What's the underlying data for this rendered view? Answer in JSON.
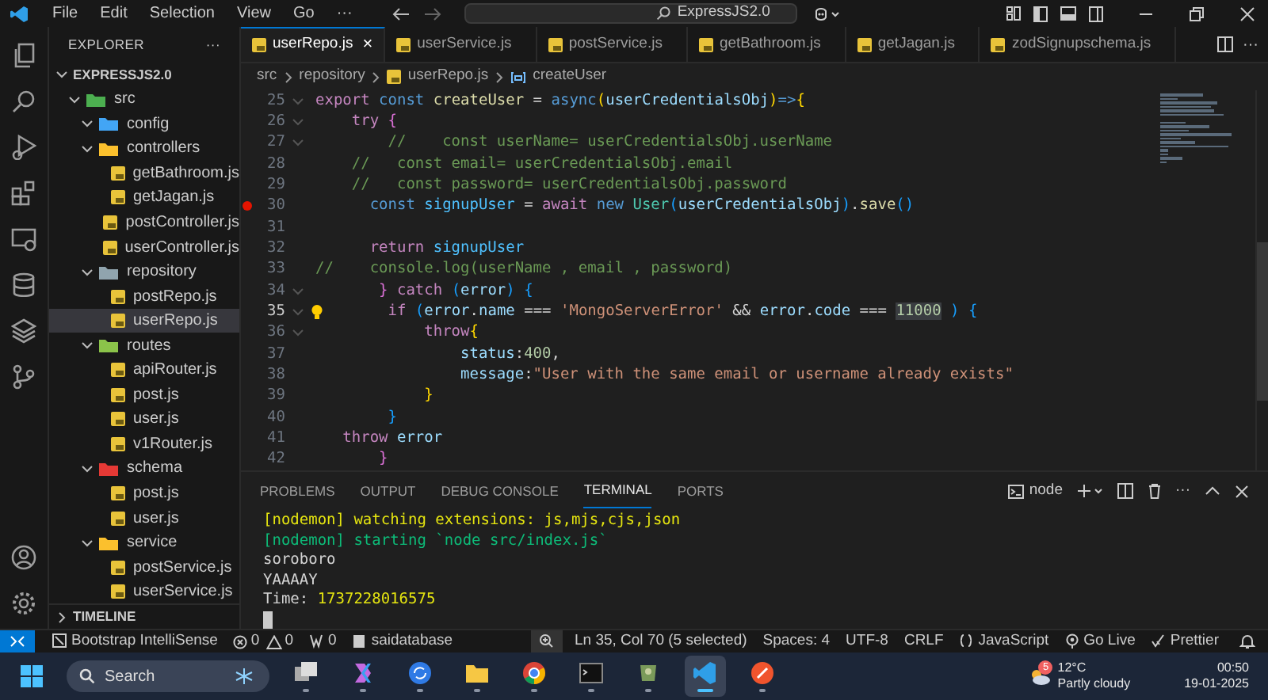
{
  "menu": [
    "File",
    "Edit",
    "Selection",
    "View",
    "Go",
    "···"
  ],
  "command_center": {
    "text": "ExpressJS2.0"
  },
  "explorer": {
    "title": "EXPLORER",
    "more": "···",
    "root": "EXPRESSJS2.0",
    "tree": [
      {
        "label": "src",
        "kind": "folder",
        "color": "#4caf50",
        "expanded": true,
        "selected": false,
        "children": [
          {
            "label": "config",
            "kind": "folder",
            "color": "#42a5f5",
            "expanded": true,
            "selected": false
          },
          {
            "label": "controllers",
            "kind": "folder",
            "color": "#fbc02d",
            "expanded": true,
            "selected": false,
            "children": [
              {
                "label": "getBathroom.js",
                "kind": "file",
                "selected": false
              },
              {
                "label": "getJagan.js",
                "kind": "file",
                "selected": false
              },
              {
                "label": "postController.js",
                "kind": "file",
                "selected": false
              },
              {
                "label": "userController.js",
                "kind": "file",
                "selected": false
              }
            ]
          },
          {
            "label": "repository",
            "kind": "folder",
            "color": "#90a4ae",
            "expanded": true,
            "selected": false,
            "children": [
              {
                "label": "postRepo.js",
                "kind": "file",
                "selected": false
              },
              {
                "label": "userRepo.js",
                "kind": "file",
                "selected": true
              }
            ]
          },
          {
            "label": "routes",
            "kind": "folder",
            "color": "#8bc34a",
            "expanded": true,
            "selected": false,
            "children": [
              {
                "label": "apiRouter.js",
                "kind": "file",
                "selected": false
              },
              {
                "label": "post.js",
                "kind": "file",
                "selected": false
              },
              {
                "label": "user.js",
                "kind": "file",
                "selected": false
              },
              {
                "label": "v1Router.js",
                "kind": "file",
                "selected": false
              }
            ]
          },
          {
            "label": "schema",
            "kind": "folder",
            "color": "#e53935",
            "expanded": true,
            "selected": false,
            "children": [
              {
                "label": "post.js",
                "kind": "file",
                "selected": false
              },
              {
                "label": "user.js",
                "kind": "file",
                "selected": false
              }
            ]
          },
          {
            "label": "service",
            "kind": "folder",
            "color": "#fbc02d",
            "expanded": true,
            "selected": false,
            "children": [
              {
                "label": "postService.js",
                "kind": "file",
                "selected": false
              },
              {
                "label": "userService.js",
                "kind": "file",
                "selected": false
              }
            ]
          }
        ]
      }
    ],
    "timeline": "TIMELINE"
  },
  "tabs": [
    {
      "label": "userRepo.js",
      "selected": true,
      "close": "×"
    },
    {
      "label": "userService.js",
      "selected": false
    },
    {
      "label": "postService.js",
      "selected": false
    },
    {
      "label": "getBathroom.js",
      "selected": false
    },
    {
      "label": "getJagan.js",
      "selected": false
    },
    {
      "label": "zodSignupschema.js",
      "selected": false
    }
  ],
  "tabs_more": "···",
  "breadcrumbs": [
    "src",
    "repository",
    "userRepo.js",
    "createUser"
  ],
  "code": [
    {
      "number": "25",
      "fold": true,
      "tokens": [
        {
          "kind": "ctrl",
          "text": "export "
        },
        {
          "kind": "kw",
          "text": "const "
        },
        {
          "kind": "fn",
          "text": "createUser "
        },
        {
          "kind": "plain",
          "text": "= "
        },
        {
          "kind": "kw",
          "text": "async"
        },
        {
          "kind": "brace",
          "text": "("
        },
        {
          "kind": "var",
          "text": "userCredentialsObj"
        },
        {
          "kind": "brace",
          "text": ")"
        },
        {
          "kind": "kw",
          "text": "=>"
        },
        {
          "kind": "brace",
          "text": "{"
        }
      ]
    },
    {
      "number": "26",
      "fold": true,
      "tokens": [
        {
          "kind": "ctrl",
          "text": "    try "
        },
        {
          "kind": "brace2",
          "text": "{"
        }
      ]
    },
    {
      "number": "27",
      "fold": true,
      "tokens": [
        {
          "kind": "cmt",
          "text": "        //    const userName= userCredentialsObj.userName"
        }
      ]
    },
    {
      "number": "28",
      "tokens": [
        {
          "kind": "cmt",
          "text": "    //   const email= userCredentialsObj.email"
        }
      ]
    },
    {
      "number": "29",
      "tokens": [
        {
          "kind": "cmt",
          "text": "    //   const password= userCredentialsObj.password"
        }
      ]
    },
    {
      "number": "30",
      "breakpoint": true,
      "tokens": [
        {
          "kind": "kw",
          "text": "      const "
        },
        {
          "kind": "cvar",
          "text": "signupUser "
        },
        {
          "kind": "plain",
          "text": "= "
        },
        {
          "kind": "ctrl",
          "text": "await "
        },
        {
          "kind": "kw",
          "text": "new "
        },
        {
          "kind": "type",
          "text": "User"
        },
        {
          "kind": "brace3",
          "text": "("
        },
        {
          "kind": "var",
          "text": "userCredentialsObj"
        },
        {
          "kind": "brace3",
          "text": ")"
        },
        {
          "kind": "plain",
          "text": "."
        },
        {
          "kind": "fn",
          "text": "save"
        },
        {
          "kind": "brace3",
          "text": "()"
        }
      ]
    },
    {
      "number": "31"
    },
    {
      "number": "32",
      "tokens": [
        {
          "kind": "ctrl",
          "text": "      return "
        },
        {
          "kind": "cvar",
          "text": "signupUser"
        }
      ]
    },
    {
      "number": "33",
      "tokens": [
        {
          "kind": "cmt",
          "text": "//    console.log(userName , email , password)"
        }
      ]
    },
    {
      "number": "34",
      "fold": true,
      "tokens": [
        {
          "kind": "brace2",
          "text": "       } "
        },
        {
          "kind": "ctrl",
          "text": "catch "
        },
        {
          "kind": "brace3",
          "text": "("
        },
        {
          "kind": "var",
          "text": "error"
        },
        {
          "kind": "brace3",
          "text": ") "
        },
        {
          "kind": "brace3",
          "text": "{"
        }
      ]
    },
    {
      "number": "35",
      "fold": true,
      "current": true,
      "lightbulb": true,
      "tokens": [
        {
          "kind": "ctrl",
          "text": "        if "
        },
        {
          "kind": "brace3",
          "text": "("
        },
        {
          "kind": "var",
          "text": "error"
        },
        {
          "kind": "plain",
          "text": "."
        },
        {
          "kind": "var",
          "text": "name"
        },
        {
          "kind": "plain",
          "text": " === "
        },
        {
          "kind": "str",
          "text": "'MongoServerError'"
        },
        {
          "kind": "plain",
          "text": " && "
        },
        {
          "kind": "var",
          "text": "error"
        },
        {
          "kind": "plain",
          "text": "."
        },
        {
          "kind": "var",
          "text": "code"
        },
        {
          "kind": "plain",
          "text": " === "
        },
        {
          "kind": "selnum",
          "text": "11000"
        },
        {
          "kind": "brace3",
          "text": " ) {"
        }
      ]
    },
    {
      "number": "36",
      "fold": true,
      "tokens": [
        {
          "kind": "ctrl",
          "text": "            throw"
        },
        {
          "kind": "brace",
          "text": "{"
        }
      ]
    },
    {
      "number": "37",
      "tokens": [
        {
          "kind": "var",
          "text": "                status"
        },
        {
          "kind": "plain",
          "text": ":"
        },
        {
          "kind": "num",
          "text": "400"
        },
        {
          "kind": "plain",
          "text": ","
        }
      ]
    },
    {
      "number": "38",
      "tokens": [
        {
          "kind": "var",
          "text": "                message"
        },
        {
          "kind": "plain",
          "text": ":"
        },
        {
          "kind": "str",
          "text": "\"User with the same email or username already exists\""
        }
      ]
    },
    {
      "number": "39",
      "tokens": [
        {
          "kind": "brace",
          "text": "            }"
        }
      ]
    },
    {
      "number": "40",
      "tokens": [
        {
          "kind": "brace3",
          "text": "        }"
        }
      ]
    },
    {
      "number": "41",
      "tokens": [
        {
          "kind": "ctrl",
          "text": "   throw "
        },
        {
          "kind": "var",
          "text": "error"
        }
      ]
    },
    {
      "number": "42",
      "tokens": [
        {
          "kind": "brace2",
          "text": "       }"
        }
      ]
    }
  ],
  "panel": {
    "tabs": [
      {
        "label": "PROBLEMS",
        "selected": false
      },
      {
        "label": "OUTPUT",
        "selected": false
      },
      {
        "label": "DEBUG CONSOLE",
        "selected": false
      },
      {
        "label": "TERMINAL",
        "selected": true
      },
      {
        "label": "PORTS",
        "selected": false
      }
    ],
    "terminal_name": "node",
    "more": "···",
    "lines": [
      [
        {
          "kind": "yellow",
          "text": "[nodemon] watching extensions: js,mjs,cjs,json"
        }
      ],
      [
        {
          "kind": "green",
          "text": "[nodemon] starting `node src/index.js`"
        }
      ],
      [
        {
          "kind": "plain",
          "text": "soroboro"
        }
      ],
      [
        {
          "kind": "plain",
          "text": "YAAAAY"
        }
      ],
      [
        {
          "kind": "plain",
          "text": "Time: "
        },
        {
          "kind": "yellow",
          "text": "1737228016575"
        }
      ]
    ]
  },
  "status_bar": {
    "left": [
      {
        "kind": "ext",
        "text": "Bootstrap IntelliSense"
      },
      {
        "kind": "problems",
        "errors": "0",
        "warnings": "0"
      },
      {
        "kind": "ports",
        "text": "0"
      },
      {
        "kind": "db",
        "text": "saidatabase"
      }
    ],
    "right": [
      {
        "kind": "plain",
        "text": "Ln 35, Col 70 (5 selected)"
      },
      {
        "kind": "plain",
        "text": "Spaces: 4"
      },
      {
        "kind": "plain",
        "text": "UTF-8"
      },
      {
        "kind": "plain",
        "text": "CRLF"
      },
      {
        "kind": "lang",
        "text": "JavaScript"
      },
      {
        "kind": "live",
        "text": "Go Live"
      },
      {
        "kind": "prettier",
        "text": "Prettier"
      }
    ]
  },
  "taskbar": {
    "search_placeholder": "Search",
    "weather": {
      "badge": "5",
      "temp": "12°C",
      "condition": "Partly cloudy"
    },
    "time": "00:50",
    "date": "19-01-2025",
    "apps": [
      {
        "kind": "taskview",
        "active": false
      },
      {
        "kind": "copilot",
        "active": false
      },
      {
        "kind": "sync",
        "active": false
      },
      {
        "kind": "folder",
        "active": false
      },
      {
        "kind": "chrome",
        "active": false
      },
      {
        "kind": "terminal",
        "active": false
      },
      {
        "kind": "game",
        "active": false
      },
      {
        "kind": "vscode",
        "active": true
      },
      {
        "kind": "compass",
        "active": false
      }
    ]
  }
}
